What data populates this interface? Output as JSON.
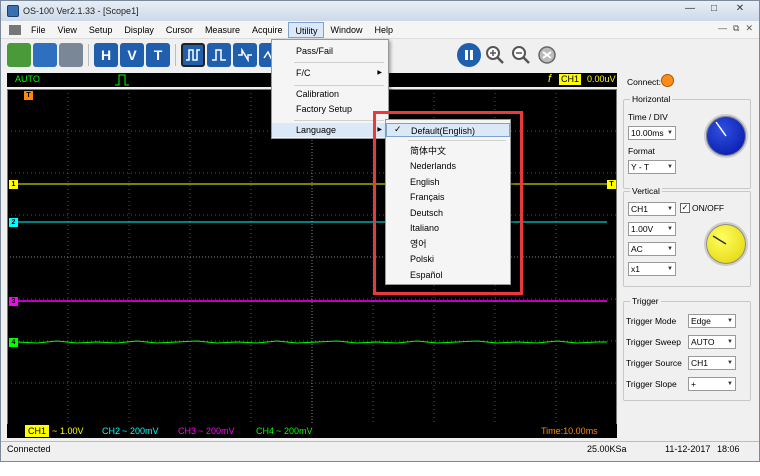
{
  "window": {
    "title": "OS-100 Ver2.1.33 - [Scope1]"
  },
  "menubar": {
    "items": [
      "File",
      "View",
      "Setup",
      "Display",
      "Cursor",
      "Measure",
      "Acquire",
      "Utility",
      "Window",
      "Help"
    ],
    "active": "Utility"
  },
  "toolbar": {
    "buttons": [
      "H",
      "V",
      "T"
    ]
  },
  "statusline": {
    "mode": "AUTO",
    "trigger_channel": "CH1",
    "trigger_level": "0.00uV"
  },
  "connect": {
    "label": "Connect:"
  },
  "horizontal": {
    "title": "Horizontal",
    "time_div_label": "Time / DIV",
    "time_div_value": "10.00ms",
    "format_label": "Format",
    "format_value": "Y - T"
  },
  "vertical": {
    "title": "Vertical",
    "channel": "CH1",
    "onoff_label": "ON/OFF",
    "volts": "1.00V",
    "coupling": "AC",
    "probe": "x1"
  },
  "trigger": {
    "title": "Trigger",
    "mode_label": "Trigger Mode",
    "mode_value": "Edge",
    "sweep_label": "Trigger Sweep",
    "sweep_value": "AUTO",
    "source_label": "Trigger Source",
    "source_value": "CH1",
    "slope_label": "Trigger Slope",
    "slope_value": "+"
  },
  "channels": [
    {
      "name": "CH1",
      "scale": "1.00V",
      "color": "#ffff00"
    },
    {
      "name": "CH2",
      "scale": "200mV",
      "color": "#00ffff"
    },
    {
      "name": "CH3",
      "scale": "200mV",
      "color": "#ff00ff"
    },
    {
      "name": "CH4",
      "scale": "200mV",
      "color": "#00ff00"
    }
  ],
  "time_readout": "Time:10.00ms",
  "statusbar": {
    "status": "Connected",
    "sample_rate": "25.00KSa",
    "date": "11-12-2017",
    "time": "18:06"
  },
  "utility_menu": {
    "items": [
      "Pass/Fail",
      "F/C",
      "Calibration",
      "Factory Setup",
      "Language"
    ]
  },
  "language_menu": {
    "items": [
      "Default(English)",
      "简体中文",
      "Nederlands",
      "English",
      "Français",
      "Deutsch",
      "Italiano",
      "영어",
      "Polski",
      "Español"
    ],
    "checked": "Default(English)"
  },
  "markers": {
    "t": "T",
    "ch1": "1",
    "ch2": "2",
    "ch3": "3",
    "ch4": "4"
  }
}
